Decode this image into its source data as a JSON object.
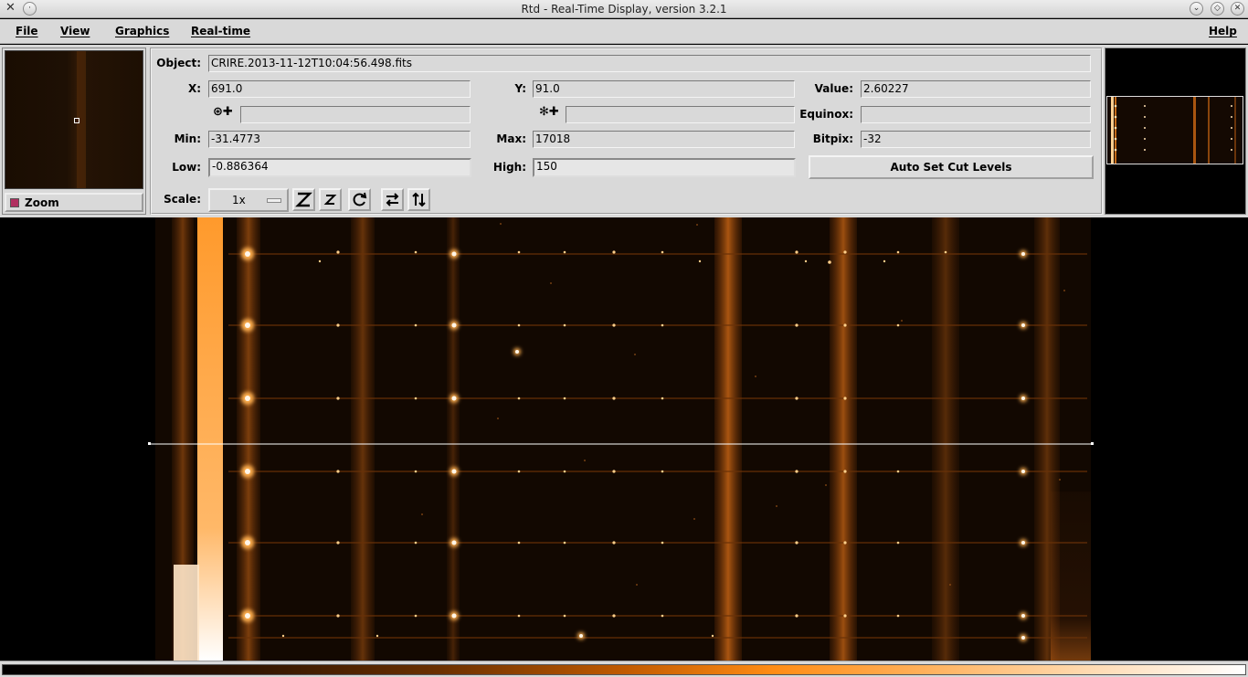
{
  "window": {
    "title": "Rtd - Real-Time Display, version 3.2.1"
  },
  "menu": {
    "file": "File",
    "view": "View",
    "graphics": "Graphics",
    "realtime": "Real-time",
    "help": "Help"
  },
  "zoom": {
    "toggle_label": "Zoom",
    "enabled": true
  },
  "info": {
    "object_label": "Object:",
    "object_value": "CRIRE.2013-11-12T10:04:56.498.fits",
    "x_label": "X:",
    "x_value": "691.0",
    "y_label": "Y:",
    "y_value": "91.0",
    "value_label": "Value:",
    "value_value": "2.60227",
    "ra_value": "",
    "dec_value": "",
    "equinox_label": "Equinox:",
    "equinox_value": "",
    "min_label": "Min:",
    "min_value": "-31.4773",
    "max_label": "Max:",
    "max_value": "17018",
    "bitpix_label": "Bitpix:",
    "bitpix_value": "-32",
    "low_label": "Low:",
    "low_value": "-0.886364",
    "high_label": "High:",
    "high_value": "150",
    "autocut_label": "Auto Set Cut Levels",
    "scale_label": "Scale:",
    "scale_value": "1x"
  },
  "toolbar_icons": [
    "zoom-in-icon",
    "zoom-out-icon",
    "rotate-icon",
    "flip-x-icon",
    "flip-y-icon"
  ],
  "colors": {
    "image_hot": "#ff8c14",
    "image_bright": "#ffe8c8",
    "background": "#d9d9d9",
    "zoom_check": "#b03060"
  }
}
